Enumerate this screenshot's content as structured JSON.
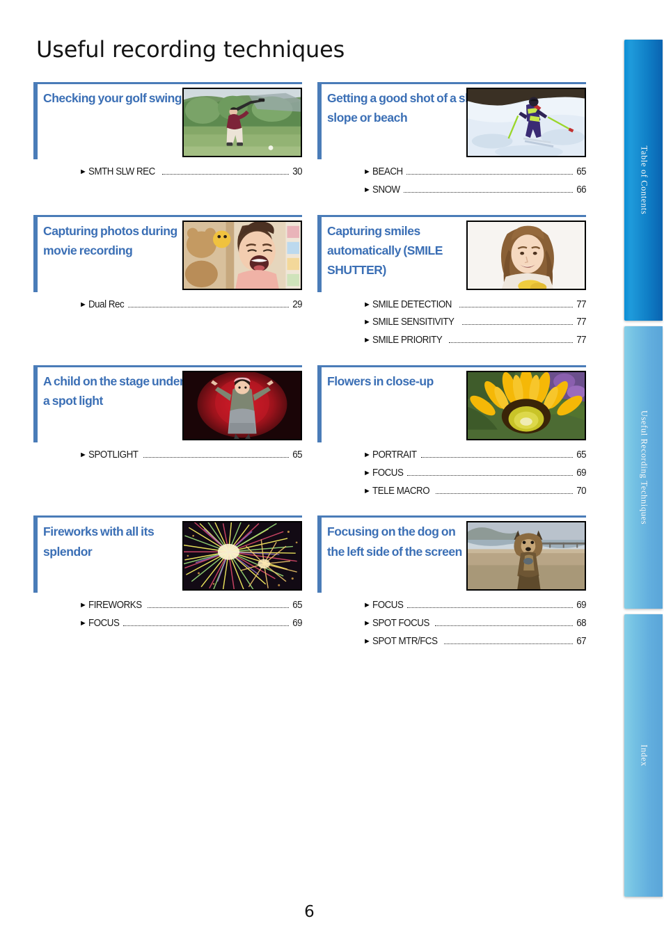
{
  "document": {
    "title": "Useful recording techniques",
    "page_number": "6"
  },
  "colors": {
    "card_accent": "#4a7cb8",
    "card_title": "#3b6fb5",
    "tab_active": "#0f7ec6",
    "tab_inactive": "#76c3e4"
  },
  "cards": [
    {
      "title": "Checking your golf swing",
      "image": "golf-swing-photo",
      "entries": [
        {
          "label": "SMTH SLW REC",
          "page": "30"
        }
      ]
    },
    {
      "title": "Getting a good shot of a ski slope or beach",
      "image": "ski-slope-photo",
      "entries": [
        {
          "label": "BEACH",
          "page": "65"
        },
        {
          "label": "SNOW",
          "page": "66"
        }
      ]
    },
    {
      "title": "Capturing photos during movie recording",
      "image": "laughing-child-photo",
      "entries": [
        {
          "label": "Dual Rec",
          "page": "29"
        }
      ]
    },
    {
      "title": "Capturing smiles automatically (SMILE SHUTTER)",
      "image": "smiling-girl-photo",
      "entries": [
        {
          "label": "SMILE DETECTION",
          "page": "77"
        },
        {
          "label": "SMILE SENSITIVITY",
          "page": "77"
        },
        {
          "label": "SMILE PRIORITY",
          "page": "77"
        }
      ]
    },
    {
      "title": "A child on the stage under a spot light",
      "image": "child-on-stage-photo",
      "entries": [
        {
          "label": "SPOTLIGHT",
          "page": "65"
        }
      ]
    },
    {
      "title": "Flowers in close-up",
      "image": "yellow-flower-photo",
      "entries": [
        {
          "label": "PORTRAIT",
          "page": "65"
        },
        {
          "label": "FOCUS",
          "page": "69"
        },
        {
          "label": "TELE MACRO",
          "page": "70"
        }
      ]
    },
    {
      "title": "Fireworks with all its splendor",
      "image": "fireworks-photo",
      "entries": [
        {
          "label": "FIREWORKS",
          "page": "65"
        },
        {
          "label": "FOCUS",
          "page": "69"
        }
      ]
    },
    {
      "title": "Focusing on the dog on the left side of the screen",
      "image": "dog-on-beach-photo",
      "entries": [
        {
          "label": "FOCUS",
          "page": "69"
        },
        {
          "label": "SPOT FOCUS",
          "page": "68"
        },
        {
          "label": "SPOT MTR/FCS",
          "page": "67"
        }
      ]
    }
  ],
  "side_tabs": [
    {
      "label": "Table of Contents",
      "state": "active"
    },
    {
      "label": "Useful Recording Techniques",
      "state": "current"
    },
    {
      "label": "Index",
      "state": "inactive"
    }
  ]
}
